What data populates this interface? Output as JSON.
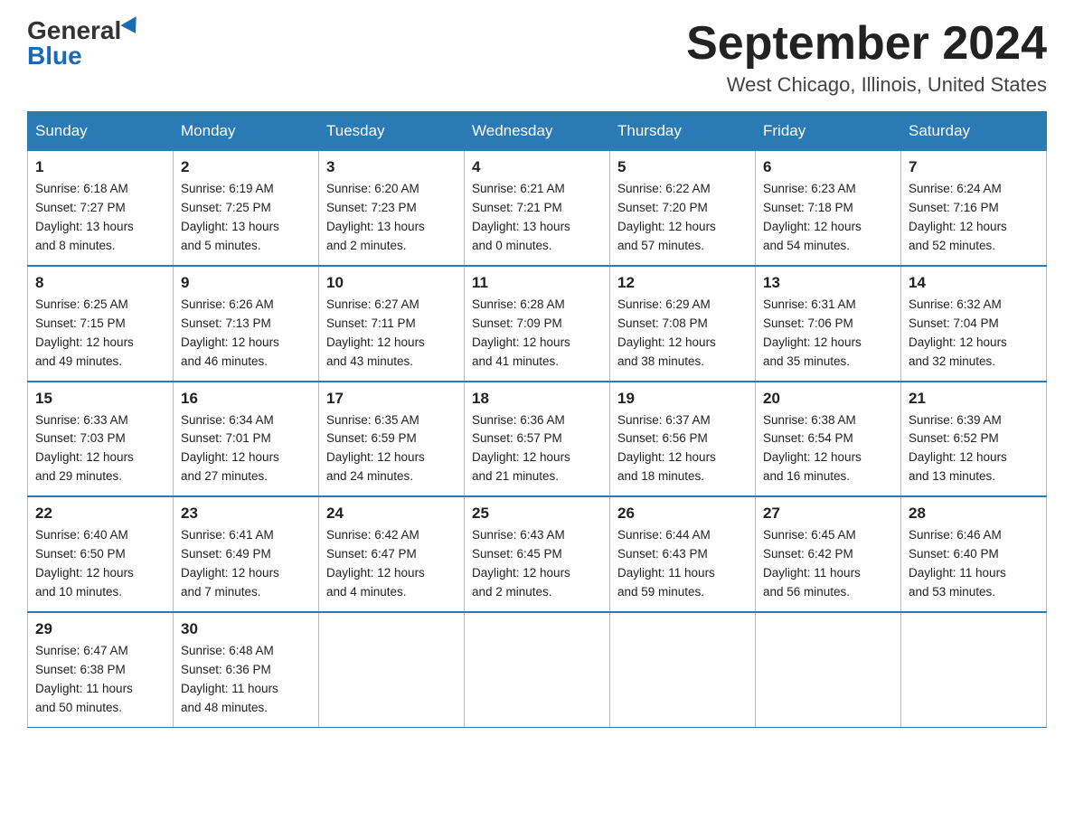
{
  "header": {
    "logo_general": "General",
    "logo_blue": "Blue",
    "month_title": "September 2024",
    "location": "West Chicago, Illinois, United States"
  },
  "days_of_week": [
    "Sunday",
    "Monday",
    "Tuesday",
    "Wednesday",
    "Thursday",
    "Friday",
    "Saturday"
  ],
  "weeks": [
    [
      {
        "day": "1",
        "sunrise": "6:18 AM",
        "sunset": "7:27 PM",
        "daylight": "13 hours and 8 minutes."
      },
      {
        "day": "2",
        "sunrise": "6:19 AM",
        "sunset": "7:25 PM",
        "daylight": "13 hours and 5 minutes."
      },
      {
        "day": "3",
        "sunrise": "6:20 AM",
        "sunset": "7:23 PM",
        "daylight": "13 hours and 2 minutes."
      },
      {
        "day": "4",
        "sunrise": "6:21 AM",
        "sunset": "7:21 PM",
        "daylight": "13 hours and 0 minutes."
      },
      {
        "day": "5",
        "sunrise": "6:22 AM",
        "sunset": "7:20 PM",
        "daylight": "12 hours and 57 minutes."
      },
      {
        "day": "6",
        "sunrise": "6:23 AM",
        "sunset": "7:18 PM",
        "daylight": "12 hours and 54 minutes."
      },
      {
        "day": "7",
        "sunrise": "6:24 AM",
        "sunset": "7:16 PM",
        "daylight": "12 hours and 52 minutes."
      }
    ],
    [
      {
        "day": "8",
        "sunrise": "6:25 AM",
        "sunset": "7:15 PM",
        "daylight": "12 hours and 49 minutes."
      },
      {
        "day": "9",
        "sunrise": "6:26 AM",
        "sunset": "7:13 PM",
        "daylight": "12 hours and 46 minutes."
      },
      {
        "day": "10",
        "sunrise": "6:27 AM",
        "sunset": "7:11 PM",
        "daylight": "12 hours and 43 minutes."
      },
      {
        "day": "11",
        "sunrise": "6:28 AM",
        "sunset": "7:09 PM",
        "daylight": "12 hours and 41 minutes."
      },
      {
        "day": "12",
        "sunrise": "6:29 AM",
        "sunset": "7:08 PM",
        "daylight": "12 hours and 38 minutes."
      },
      {
        "day": "13",
        "sunrise": "6:31 AM",
        "sunset": "7:06 PM",
        "daylight": "12 hours and 35 minutes."
      },
      {
        "day": "14",
        "sunrise": "6:32 AM",
        "sunset": "7:04 PM",
        "daylight": "12 hours and 32 minutes."
      }
    ],
    [
      {
        "day": "15",
        "sunrise": "6:33 AM",
        "sunset": "7:03 PM",
        "daylight": "12 hours and 29 minutes."
      },
      {
        "day": "16",
        "sunrise": "6:34 AM",
        "sunset": "7:01 PM",
        "daylight": "12 hours and 27 minutes."
      },
      {
        "day": "17",
        "sunrise": "6:35 AM",
        "sunset": "6:59 PM",
        "daylight": "12 hours and 24 minutes."
      },
      {
        "day": "18",
        "sunrise": "6:36 AM",
        "sunset": "6:57 PM",
        "daylight": "12 hours and 21 minutes."
      },
      {
        "day": "19",
        "sunrise": "6:37 AM",
        "sunset": "6:56 PM",
        "daylight": "12 hours and 18 minutes."
      },
      {
        "day": "20",
        "sunrise": "6:38 AM",
        "sunset": "6:54 PM",
        "daylight": "12 hours and 16 minutes."
      },
      {
        "day": "21",
        "sunrise": "6:39 AM",
        "sunset": "6:52 PM",
        "daylight": "12 hours and 13 minutes."
      }
    ],
    [
      {
        "day": "22",
        "sunrise": "6:40 AM",
        "sunset": "6:50 PM",
        "daylight": "12 hours and 10 minutes."
      },
      {
        "day": "23",
        "sunrise": "6:41 AM",
        "sunset": "6:49 PM",
        "daylight": "12 hours and 7 minutes."
      },
      {
        "day": "24",
        "sunrise": "6:42 AM",
        "sunset": "6:47 PM",
        "daylight": "12 hours and 4 minutes."
      },
      {
        "day": "25",
        "sunrise": "6:43 AM",
        "sunset": "6:45 PM",
        "daylight": "12 hours and 2 minutes."
      },
      {
        "day": "26",
        "sunrise": "6:44 AM",
        "sunset": "6:43 PM",
        "daylight": "11 hours and 59 minutes."
      },
      {
        "day": "27",
        "sunrise": "6:45 AM",
        "sunset": "6:42 PM",
        "daylight": "11 hours and 56 minutes."
      },
      {
        "day": "28",
        "sunrise": "6:46 AM",
        "sunset": "6:40 PM",
        "daylight": "11 hours and 53 minutes."
      }
    ],
    [
      {
        "day": "29",
        "sunrise": "6:47 AM",
        "sunset": "6:38 PM",
        "daylight": "11 hours and 50 minutes."
      },
      {
        "day": "30",
        "sunrise": "6:48 AM",
        "sunset": "6:36 PM",
        "daylight": "11 hours and 48 minutes."
      },
      null,
      null,
      null,
      null,
      null
    ]
  ],
  "labels": {
    "sunrise": "Sunrise:",
    "sunset": "Sunset:",
    "daylight": "Daylight:"
  }
}
